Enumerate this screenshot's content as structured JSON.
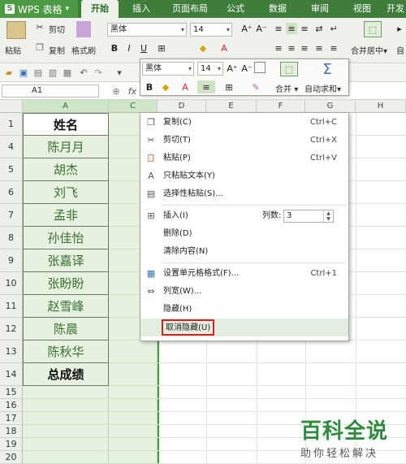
{
  "app": {
    "logo": "S",
    "title": "WPS 表格",
    "caret": "▾"
  },
  "tabs": [
    {
      "label": "开始",
      "active": true
    },
    {
      "label": "插入"
    },
    {
      "label": "页面布局"
    },
    {
      "label": "公式"
    },
    {
      "label": "数据"
    },
    {
      "label": "审阅"
    },
    {
      "label": "视图"
    },
    {
      "label": "开发"
    }
  ],
  "ribbon": {
    "paste": "粘贴",
    "cut": "剪切",
    "copy": "复制",
    "format_painter": "格式刷",
    "font": "黑体",
    "font_size": "14",
    "bold": "B",
    "italic": "I",
    "underline": "U",
    "merge": "合并居中",
    "merge_caret": "▾",
    "autowrap": "自",
    "orient_icon": "⇄",
    "wrap_icon": "↵",
    "merge_icon": "⬚",
    "more_icon": "▸"
  },
  "namebox": {
    "value": "A1"
  },
  "formula": {
    "fx": "fx"
  },
  "minibar": {
    "font": "黑体",
    "size": "14",
    "merge": "合并",
    "autosum": "自动求和",
    "bold": "B",
    "sigma": "Σ",
    "dropdown_caret": "▾"
  },
  "columns": [
    "A",
    "C",
    "D",
    "E",
    "F",
    "G",
    "H"
  ],
  "rows": [
    {
      "num": "1",
      "name": "姓名",
      "header": true
    },
    {
      "num": "4",
      "name": "陈月月"
    },
    {
      "num": "5",
      "name": "胡杰"
    },
    {
      "num": "6",
      "name": "刘飞"
    },
    {
      "num": "7",
      "name": "孟非"
    },
    {
      "num": "8",
      "name": "孙佳怡"
    },
    {
      "num": "9",
      "name": "张嘉译"
    },
    {
      "num": "10",
      "name": "张盼盼"
    },
    {
      "num": "11",
      "name": "赵雪峰"
    },
    {
      "num": "12",
      "name": "陈晨"
    },
    {
      "num": "13",
      "name": "陈秋华"
    },
    {
      "num": "14",
      "name": "总成绩",
      "header": true
    },
    {
      "num": "15",
      "name": ""
    },
    {
      "num": "16",
      "name": ""
    },
    {
      "num": "17",
      "name": ""
    },
    {
      "num": "18",
      "name": ""
    },
    {
      "num": "19",
      "name": ""
    },
    {
      "num": "20",
      "name": ""
    }
  ],
  "context_menu": {
    "items": [
      {
        "label": "复制(C)",
        "shortcut": "Ctrl+C",
        "icon": "copy-icon",
        "glyph": "❐"
      },
      {
        "label": "剪切(T)",
        "shortcut": "Ctrl+X",
        "icon": "cut-icon",
        "glyph": "✂"
      },
      {
        "label": "粘贴(P)",
        "shortcut": "Ctrl+V",
        "icon": "paste-icon",
        "glyph": "📋"
      },
      {
        "label": "只粘贴文本(Y)",
        "shortcut": "",
        "icon": "paste-text-icon",
        "glyph": "A"
      },
      {
        "label": "选择性粘贴(S)...",
        "shortcut": "",
        "icon": "paste-special-icon",
        "glyph": "▤"
      },
      {
        "label": "插入(I)",
        "shortcut": "",
        "icon": "insert-icon",
        "glyph": "⊞"
      },
      {
        "label": "删除(D)",
        "shortcut": "",
        "icon": "",
        "glyph": ""
      },
      {
        "label": "清除内容(N)",
        "shortcut": "",
        "icon": "",
        "glyph": ""
      },
      {
        "label": "设置单元格格式(F)...",
        "shortcut": "Ctrl+1",
        "icon": "format-cells-icon",
        "glyph": "▦"
      },
      {
        "label": "列宽(W)...",
        "shortcut": "",
        "icon": "column-width-icon",
        "glyph": "⇔"
      },
      {
        "label": "隐藏(H)",
        "shortcut": "",
        "icon": "",
        "glyph": ""
      },
      {
        "label": "取消隐藏(U)",
        "shortcut": "",
        "icon": "",
        "glyph": ""
      }
    ],
    "col_count_label": "列数:",
    "col_count_value": "3",
    "spin_up": "▲",
    "spin_down": "▼"
  },
  "watermark": {
    "title": "百科全说",
    "subtitle": "助你轻松解决"
  }
}
